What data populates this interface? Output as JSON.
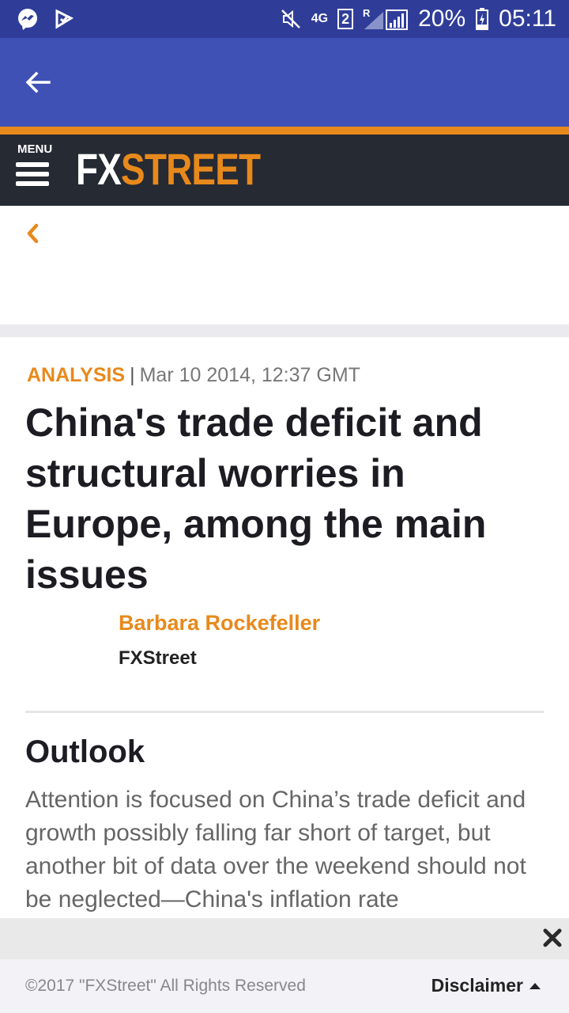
{
  "status_bar": {
    "network": "4G",
    "sim": "2",
    "roaming": "R",
    "battery": "20%",
    "time": "05:11",
    "icons": [
      "messenger-icon",
      "clipboard-check-icon",
      "mute-icon",
      "signal-icon",
      "battery-charging-icon"
    ]
  },
  "app_bar": {
    "back_icon": "arrow-left-icon"
  },
  "header": {
    "menu_label": "MENU",
    "logo_fx": "FX",
    "logo_street": "STREET",
    "accent_color": "#e8891c"
  },
  "nav": {
    "back_icon": "chevron-left-icon"
  },
  "article": {
    "category": "ANALYSIS",
    "separator": "|",
    "date": "Mar 10 2014, 12:37 GMT",
    "title": "China's trade deficit and structural worries in Europe, among the main issues",
    "author": "Barbara Rockefeller",
    "source": "FXStreet",
    "section_heading": "Outlook",
    "body": "Attention is focused on China’s trade deficit and growth possibly falling far short of target, but another bit of data over the weekend should not be neglected—China's inflation rate"
  },
  "footer": {
    "copyright": "©2017 \"FXStreet\" All Rights Reserved",
    "disclaimer_label": "Disclaimer"
  }
}
